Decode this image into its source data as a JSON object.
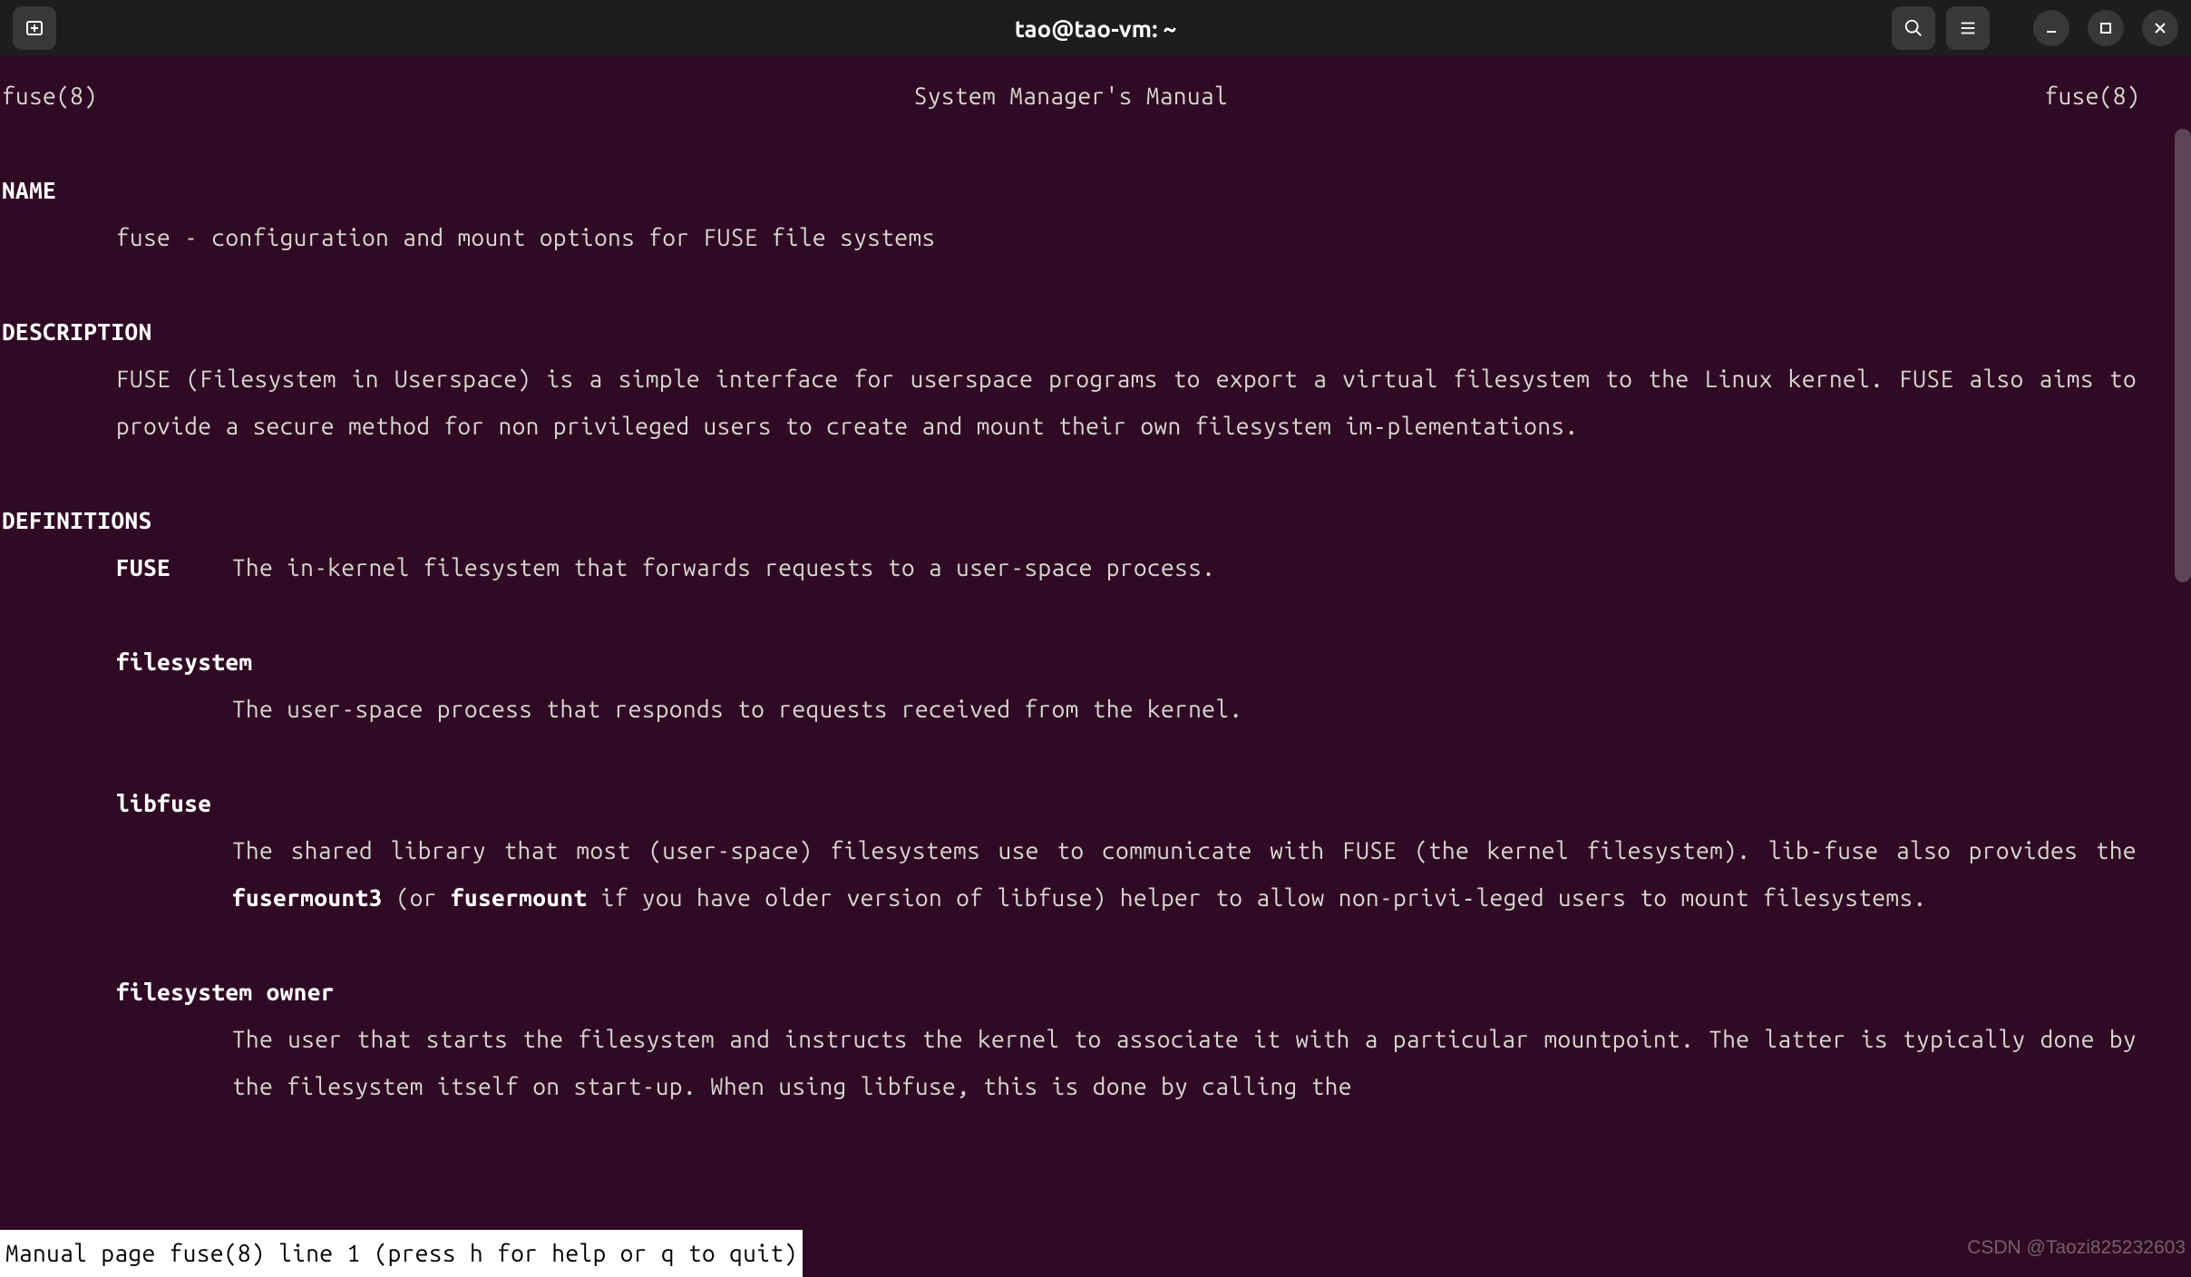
{
  "titlebar": {
    "title": "tao@tao-vm: ~"
  },
  "man": {
    "header_left": "fuse(8)",
    "header_center": "System Manager's Manual",
    "header_right": "fuse(8)",
    "sections": {
      "name": {
        "heading": "NAME",
        "text": "fuse - configuration and mount options for FUSE file systems"
      },
      "description": {
        "heading": "DESCRIPTION",
        "text": "FUSE  (Filesystem  in Userspace) is a simple interface for userspace programs to export a virtual filesystem to the Linux kernel. FUSE also aims to provide a secure method for non privileged users to create and mount their own  filesystem  im‐plementations."
      },
      "definitions": {
        "heading": "DEFINITIONS",
        "items": [
          {
            "term": "FUSE",
            "desc": "The in-kernel filesystem that forwards requests to a user-space process."
          },
          {
            "term": "filesystem",
            "desc": "The user-space process that responds to requests received from the kernel."
          },
          {
            "term": "libfuse",
            "desc_pre": "The  shared  library that most (user-space) filesystems use to communicate with FUSE (the kernel filesystem). lib‐fuse also provides the ",
            "bold1": "fusermount3",
            "desc_mid": " (or ",
            "bold2": "fusermount",
            "desc_post": " if you have older version of libfuse) helper to allow non-privi‐leged users to mount filesystems."
          },
          {
            "term": "filesystem owner",
            "desc": "The  user  that  starts  the filesystem and instructs the kernel to associate it with a particular mountpoint. The latter is typically done by the filesystem itself on start-up. When using libfuse, this is  done  by  calling  the"
          }
        ]
      }
    },
    "status_line": " Manual page fuse(8) line 1 (press h for help or q to quit)"
  },
  "watermark": "CSDN @Taozi825232603"
}
